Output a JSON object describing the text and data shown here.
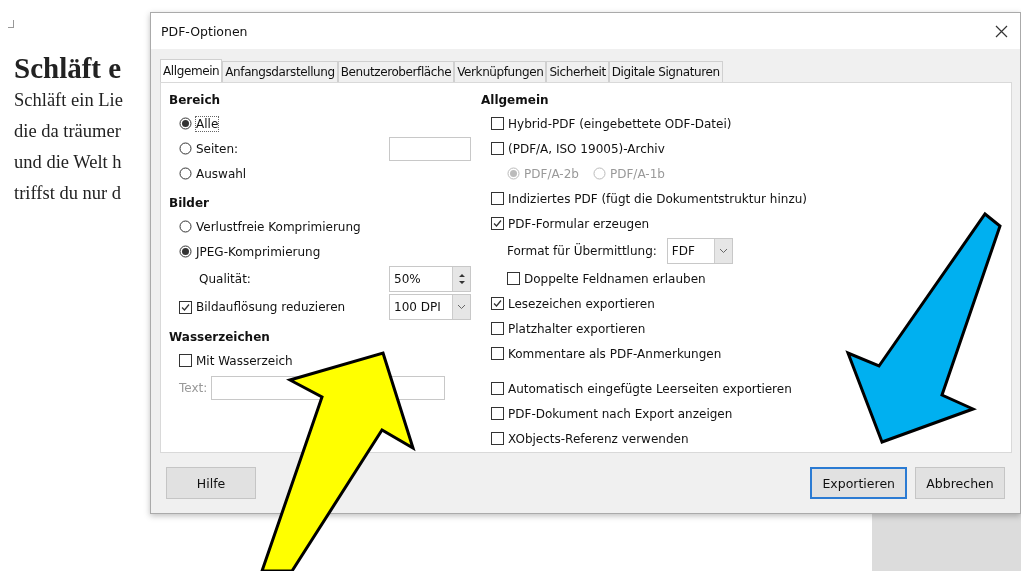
{
  "document": {
    "heading": "Schläft e",
    "lines": [
      "Schläft ein Lie",
      "die da träumer",
      "und die Welt h",
      "triffst du nur d"
    ]
  },
  "dialog": {
    "title": "PDF-Optionen",
    "tabs": [
      {
        "label": "Allgemein",
        "selected": true
      },
      {
        "label": "Anfangsdarstellung",
        "selected": false
      },
      {
        "label": "Benutzeroberfläche",
        "selected": false
      },
      {
        "label": "Verknüpfungen",
        "selected": false
      },
      {
        "label": "Sicherheit",
        "selected": false
      },
      {
        "label": "Digitale Signaturen",
        "selected": false
      }
    ],
    "left": [
      {
        "heading": "Bereich",
        "items": [
          {
            "kind": "radio",
            "label": "Alle",
            "selected": true,
            "focused": true
          },
          {
            "kind": "radio",
            "label": "Seiten:",
            "selected": false,
            "with_field": true
          },
          {
            "kind": "radio",
            "label": "Auswahl",
            "selected": false
          }
        ]
      },
      {
        "heading": "Bilder",
        "items": [
          {
            "kind": "radio",
            "label": "Verlustfreie Komprimierung",
            "selected": false
          },
          {
            "kind": "radio",
            "label": "JPEG-Komprimierung",
            "selected": true,
            "children": [
              {
                "kind": "spin",
                "label": "Qualität:",
                "value": "50%"
              }
            ]
          },
          {
            "kind": "checkbox",
            "label": "Bildauflösung reduzieren",
            "checked": true,
            "select": {
              "value": "100 DPI"
            }
          }
        ]
      },
      {
        "heading": "Wasserzeichen",
        "items": [
          {
            "kind": "checkbox",
            "label": "Mit Wasserzeich",
            "checked": false
          },
          {
            "kind": "field",
            "label": "Text:",
            "disabled": true
          }
        ]
      }
    ],
    "right": [
      {
        "heading": "Allgemein",
        "items": [
          {
            "kind": "checkbox",
            "label": "Hybrid-PDF (eingebettete ODF-Datei)",
            "checked": false
          },
          {
            "kind": "checkbox",
            "label": "(PDF/A, ISO 19005)-Archiv",
            "checked": false,
            "children": [
              {
                "kind": "radios",
                "options": [
                  {
                    "label": "PDF/A-2b",
                    "selected": true,
                    "disabled": true
                  },
                  {
                    "label": "PDF/A-1b",
                    "selected": false,
                    "disabled": true
                  }
                ]
              }
            ]
          },
          {
            "kind": "checkbox",
            "label": "Indiziertes PDF (fügt die Dokumentstruktur hinzu)",
            "checked": false
          },
          {
            "kind": "checkbox",
            "label": "PDF-Formular erzeugen",
            "checked": true,
            "children": [
              {
                "kind": "select",
                "label": "Format für Übermittlung:",
                "value": "FDF"
              },
              {
                "kind": "checkbox",
                "label": "Doppelte Feldnamen erlauben",
                "checked": false
              }
            ]
          },
          {
            "kind": "checkbox",
            "label": "Lesezeichen exportieren",
            "checked": true
          },
          {
            "kind": "checkbox",
            "label": "Platzhalter exportieren",
            "checked": false
          },
          {
            "kind": "checkbox",
            "label": "Kommentare als PDF-Anmerkungen",
            "checked": false
          }
        ]
      },
      {
        "items": [
          {
            "kind": "checkbox",
            "label": "Automatisch eingefügte Leerseiten exportieren",
            "checked": false
          },
          {
            "kind": "checkbox",
            "label": "PDF-Dokument nach Export anzeigen",
            "checked": false
          },
          {
            "kind": "checkbox",
            "label": "XObjects-Referenz verwenden",
            "checked": false
          }
        ]
      }
    ],
    "help_button": "Hilfe",
    "buttons": [
      {
        "label": "Exportieren",
        "default": true
      },
      {
        "label": "Abbrechen",
        "default": false
      }
    ]
  },
  "annotations": [
    {
      "kind": "arrow",
      "color": "#ffff00"
    },
    {
      "kind": "arrow",
      "color": "#00b0f0"
    }
  ]
}
